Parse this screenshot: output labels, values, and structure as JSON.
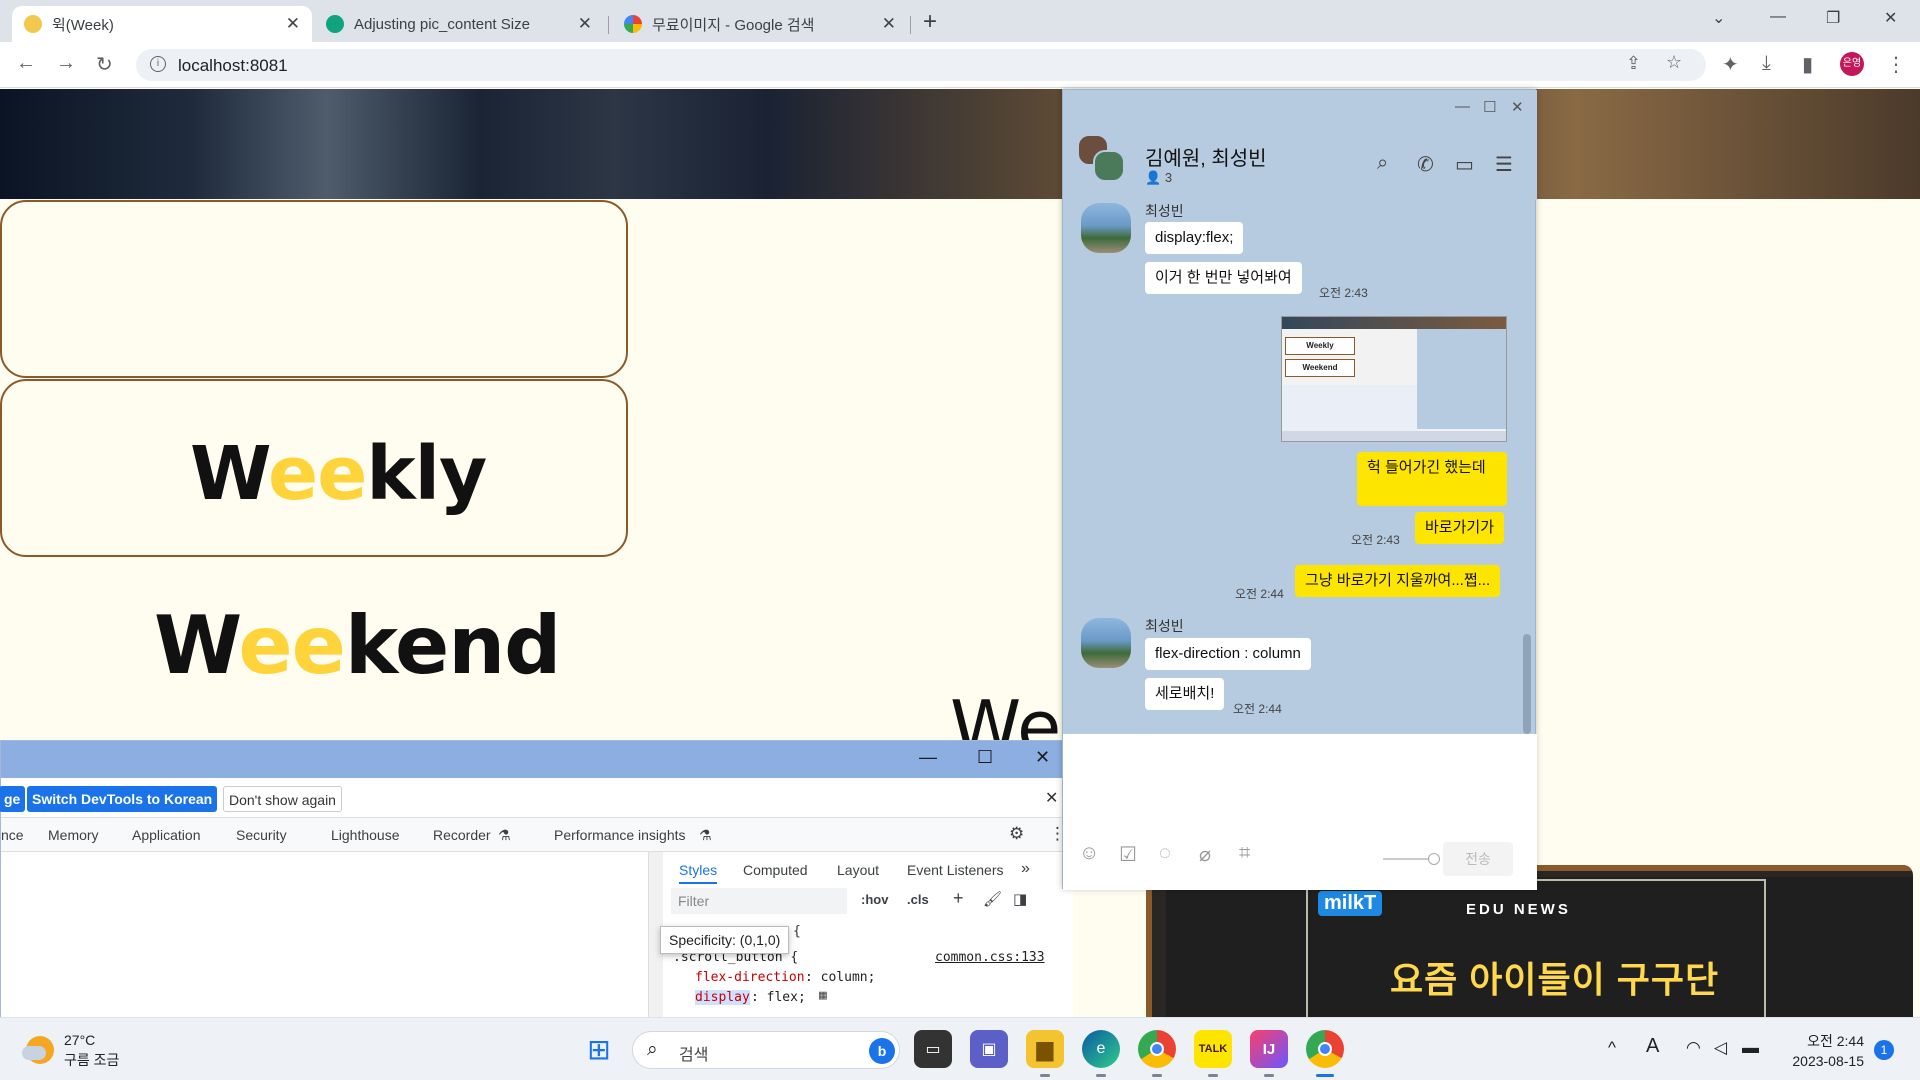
{
  "browser": {
    "tabs": [
      {
        "title": "윅(Week)",
        "active": true
      },
      {
        "title": "Adjusting pic_content Size",
        "active": false
      },
      {
        "title": "무료이미지 - Google 검색",
        "active": false
      }
    ],
    "url": "localhost:8081",
    "profile_initials": "은영"
  },
  "page": {
    "weekly_prefix": "W",
    "weekly_highlight": "ee",
    "weekly_suffix": "kly",
    "weekend_prefix": "W",
    "weekend_highlight": "ee",
    "weekend_suffix": "kend",
    "partial_heading": "We"
  },
  "devtools": {
    "banner": {
      "partial_button": "ge",
      "switch_button": "Switch DevTools to Korean",
      "dont_show_button": "Don't show again"
    },
    "tabs": [
      "nce",
      "Memory",
      "Application",
      "Security",
      "Lighthouse",
      "Recorder",
      "Performance insights"
    ],
    "styles_tabs": [
      "Styles",
      "Computed",
      "Layout",
      "Event Listeners"
    ],
    "filter_placeholder": "Filter",
    "hov": ":hov",
    "cls": ".cls",
    "tooltip": "Specificity: (0,1,0)",
    "code": {
      "brace_line": "{",
      "selector": ".scroll_button {",
      "source": "common.css:133",
      "prop1_name": "flex-direction",
      "prop1_value": ": column;",
      "prop2_name": "display",
      "prop2_value": ": flex;"
    }
  },
  "kakao": {
    "room_title": "김예원, 최성빈",
    "member_count": "3",
    "messages": {
      "sender1": "최성빈",
      "m1": "display:flex;",
      "m2": "이거 한 번만 넣어봐여",
      "t2": "오전 2:43",
      "m3": "헉 들어가긴 했는데",
      "m4": "바로가기가",
      "t4": "오전 2:43",
      "m5": "그냥 바로가기 지울까여...쩝...",
      "t5": "오전 2:44",
      "sender2": "최성빈",
      "m6": "flex-direction : column",
      "m7": "세로배치!",
      "t7": "오전 2:44"
    },
    "send_button": "전송",
    "thumb_weekly": "Weekly",
    "thumb_weekend": "Weekend"
  },
  "ad": {
    "logo": "milkT",
    "edu": "EDU NEWS",
    "headline": "요즘 아이들이 구구단"
  },
  "taskbar": {
    "temperature": "27°C",
    "weather": "구름 조금",
    "search": "검색",
    "time": "오전 2:44",
    "date": "2023-08-15",
    "notifications": "1"
  },
  "colors": {
    "accent_yellow": "#ffd43b",
    "card_border": "#8b5a2b",
    "kakao_bg": "#b6cbe0",
    "kakao_bubble": "#fee500",
    "devtools_blue": "#1a73e8"
  }
}
